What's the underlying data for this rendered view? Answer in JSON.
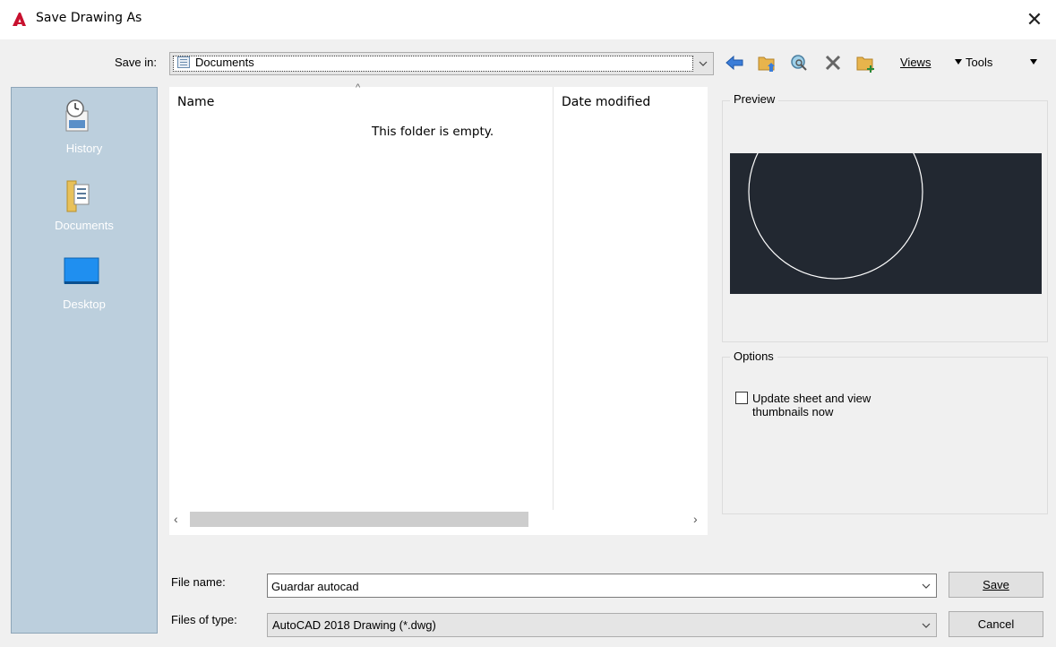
{
  "window": {
    "title": "Save Drawing As",
    "close_glyph": "✕",
    "app_icon": "autocad-logo-icon",
    "accent": "#c8102e"
  },
  "toolbar": {
    "save_in_label": "Save in:",
    "save_in_value": "Documents",
    "views_label": "Views",
    "tools_label": "Tools"
  },
  "places": [
    {
      "label": "History",
      "icon": "history-icon"
    },
    {
      "label": "Documents",
      "icon": "documents-folder-icon"
    },
    {
      "label": "Desktop",
      "icon": "desktop-icon"
    }
  ],
  "filelist": {
    "columns": [
      "Name",
      "Date modified"
    ],
    "empty_message": "This folder is empty.",
    "sort_glyph": "^"
  },
  "preview": {
    "title": "Preview",
    "canvas_color": "#222831"
  },
  "options": {
    "title": "Options",
    "update_thumbnails_line1": "Update sheet and view",
    "update_thumbnails_line2": "thumbnails now",
    "update_thumbnails_checked": false
  },
  "footer": {
    "file_name_label": "File name:",
    "file_name_value": "Guardar autocad",
    "file_type_label": "Files of type:",
    "file_type_value": "AutoCAD 2018 Drawing (*.dwg)",
    "save_label": "Save",
    "cancel_label": "Cancel"
  }
}
